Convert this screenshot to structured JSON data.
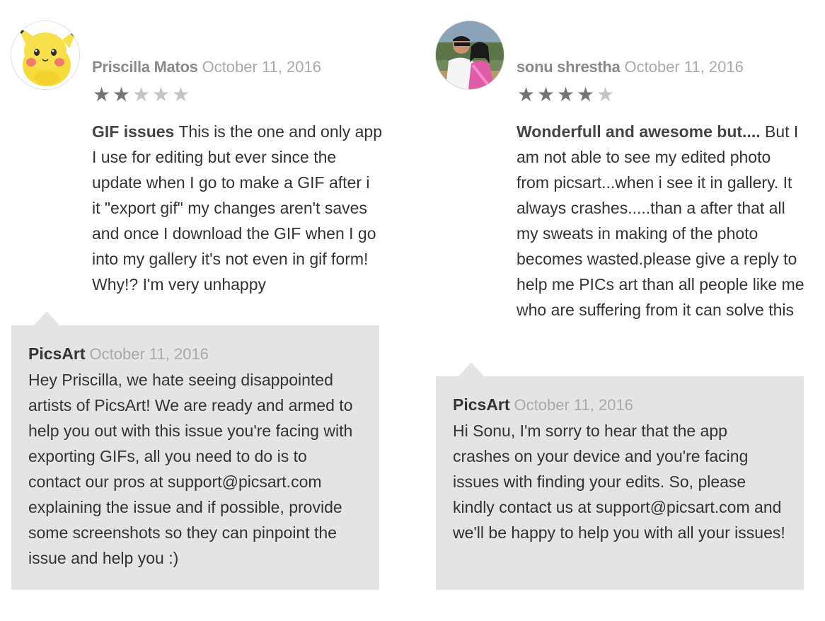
{
  "reviews": [
    {
      "author": "Priscilla Matos",
      "date": "October 11, 2016",
      "rating": 2,
      "rating_max": 5,
      "avatar_icon": "pikachu-avatar",
      "title": "GIF issues",
      "text": "This is the one and only app I use for editing but ever since the update when I go to make a GIF after i it \"export gif\" my changes aren't saves and once I download the GIF when I go into my gallery it's not even in gif form! Why!? I'm very unhappy",
      "reply": {
        "author": "PicsArt",
        "date": "October 11, 2016",
        "text": "Hey Priscilla, we hate seeing disappointed artists of PicsArt! We are ready and armed to help you out with this issue you're facing with exporting GIFs, all you need to do is to contact our pros at support@picsart.com explaining the issue and if possible, provide some screenshots so they can pinpoint the issue and help you :)"
      }
    },
    {
      "author": "sonu shrestha",
      "date": "October 11, 2016",
      "rating": 4,
      "rating_max": 5,
      "avatar_icon": "couple-photo-avatar",
      "title": "Wonderfull and awesome but....",
      "text": "But I am not able to see my edited photo from picsart...when i see it in gallery. It always crashes.....than a after that all my sweats in making of the photo becomes wasted.please give a reply to help me PICs art than all people like me who are suffering from it can solve this",
      "reply": {
        "author": "PicsArt",
        "date": "October 11, 2016",
        "text": "Hi Sonu, I'm sorry to hear that the app crashes on your device and you're facing issues with finding your edits. So, please kindly contact us at support@picsart.com and we'll be happy to help you with all your issues!"
      }
    }
  ],
  "colors": {
    "reply_background": "#e4e4e4",
    "star_filled": "#747474",
    "star_empty": "#c4c4c4",
    "author_text": "#8a8a8a",
    "date_text": "#a9a9a9",
    "body_text": "#333333"
  }
}
